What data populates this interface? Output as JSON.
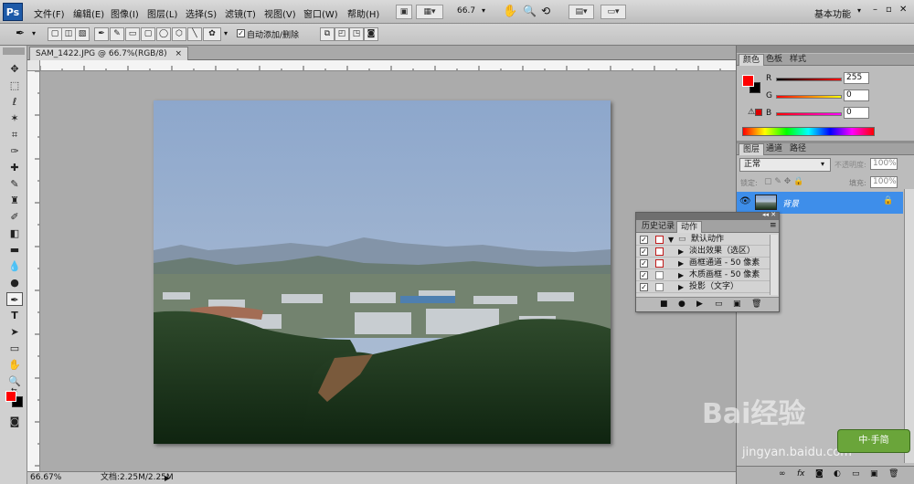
{
  "menu": {
    "items": [
      "文件(F)",
      "编辑(E)",
      "图像(I)",
      "图层(L)",
      "选择(S)",
      "滤镜(T)",
      "视图(V)",
      "窗口(W)",
      "帮助(H)"
    ],
    "zoom": "66.7",
    "workspace": "基本功能",
    "app_logo": "Ps"
  },
  "options": {
    "auto_add_delete": "自动添加/删除"
  },
  "document": {
    "tab_title": "SAM_1422.JPG @ 66.7%(RGB/8)",
    "close": "×"
  },
  "status": {
    "zoom": "66.67%",
    "doc_info": "文档:2.25M/2.25M"
  },
  "color_panel": {
    "tabs": [
      "颜色",
      "色板",
      "样式"
    ],
    "channels": [
      {
        "label": "R",
        "value": "255"
      },
      {
        "label": "G",
        "value": "0"
      },
      {
        "label": "B",
        "value": "0"
      }
    ]
  },
  "layers_panel": {
    "tabs": [
      "图层",
      "通道",
      "路径"
    ],
    "blend_mode": "正常",
    "opacity_label": "不透明度:",
    "opacity": "100%",
    "lock_label": "锁定:",
    "fill_label": "填充:",
    "fill": "100%",
    "layer_name": "背景"
  },
  "actions_panel": {
    "tabs": [
      "历史记录",
      "动作"
    ],
    "set_name": "默认动作",
    "items": [
      "淡出效果（选区）",
      "画框通道 - 50 像素",
      "木质画框 - 50 像素",
      "投影（文字）"
    ]
  },
  "watermark": {
    "site": "jingyan.baidu.com",
    "brand": "Bai经验",
    "badge": "中·手简"
  },
  "colors": {
    "fg": "#ff0000",
    "bg": "#000000",
    "layer_selected": "#3e8eea"
  }
}
